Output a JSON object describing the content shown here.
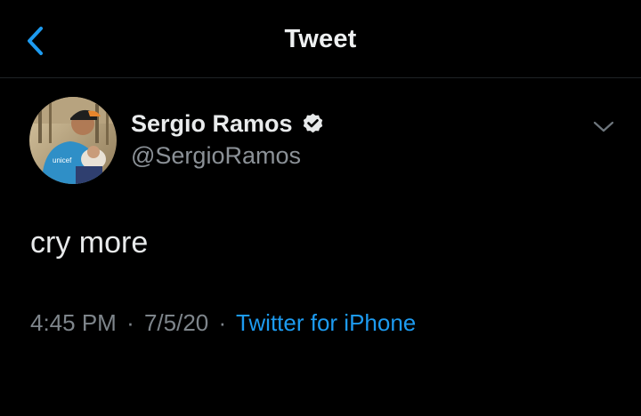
{
  "header": {
    "back_icon": "chevron-left-icon",
    "title": "Tweet"
  },
  "tweet": {
    "author": {
      "name": "Sergio Ramos",
      "handle": "@SergioRamos",
      "verified": true,
      "avatar": "avatar-photo"
    },
    "menu_icon": "chevron-down-icon",
    "text": "cry more",
    "meta": {
      "time": "4:45 PM",
      "date": "7/5/20",
      "separator": "·",
      "source": "Twitter for iPhone"
    }
  },
  "colors": {
    "background": "#000000",
    "accent": "#1d9bf0",
    "secondary_text": "#7e858b"
  }
}
